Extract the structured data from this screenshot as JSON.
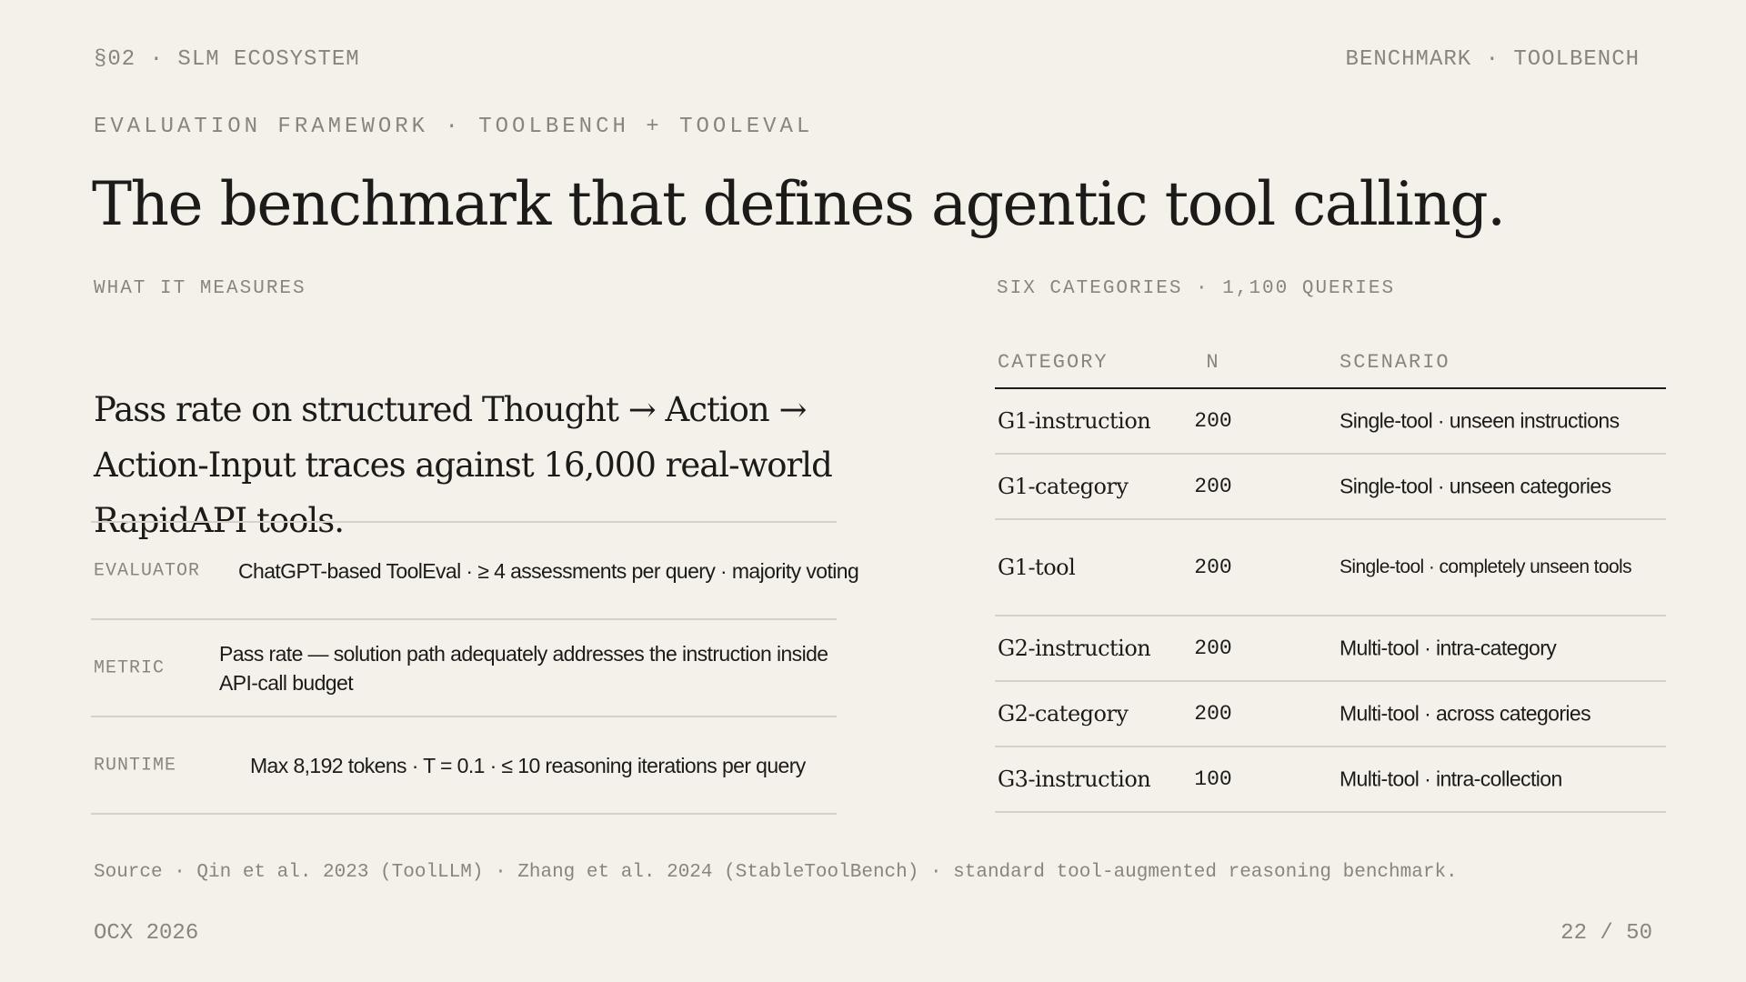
{
  "header": {
    "section": "§02 · SLM ECOSYSTEM",
    "topic": "BENCHMARK · TOOLBENCH"
  },
  "eyebrow": "EVALUATION FRAMEWORK · TOOLBENCH + TOOLEVAL",
  "title": "The benchmark that defines agentic tool calling.",
  "left": {
    "label": "WHAT IT MEASURES",
    "lede": "Pass rate on structured Thought → Action → Action-Input traces against 16,000 real-world RapidAPI tools.",
    "specs": [
      {
        "key": "EVALUATOR",
        "value": "ChatGPT-based ToolEval · ≥ 4 assessments per query · majority voting"
      },
      {
        "key": "METRIC",
        "value": "Pass rate — solution path adequately addresses the instruction inside API-call budget"
      },
      {
        "key": "RUNTIME",
        "value": "Max 8,192 tokens · T = 0.1 · ≤ 10 reasoning iterations per query"
      }
    ]
  },
  "right": {
    "label": "SIX CATEGORIES · 1,100 QUERIES",
    "columns": [
      "CATEGORY",
      "N",
      "SCENARIO"
    ],
    "rows": [
      {
        "category": "G1-instruction",
        "n": "200",
        "scenario": "Single-tool · unseen instructions"
      },
      {
        "category": "G1-category",
        "n": "200",
        "scenario": "Single-tool · unseen categories"
      },
      {
        "category": "G1-tool",
        "n": "200",
        "scenario": "Single-tool · completely unseen tools"
      },
      {
        "category": "G2-instruction",
        "n": "200",
        "scenario": "Multi-tool · intra-category"
      },
      {
        "category": "G2-category",
        "n": "200",
        "scenario": "Multi-tool · across categories"
      },
      {
        "category": "G3-instruction",
        "n": "100",
        "scenario": "Multi-tool · intra-collection"
      }
    ]
  },
  "source": "Source · Qin et al. 2023 (ToolLLM) · Zhang et al. 2024 (StableToolBench) · standard tool-augmented reasoning benchmark.",
  "footer": {
    "org": "OCX 2026",
    "page": "22 / 50"
  }
}
